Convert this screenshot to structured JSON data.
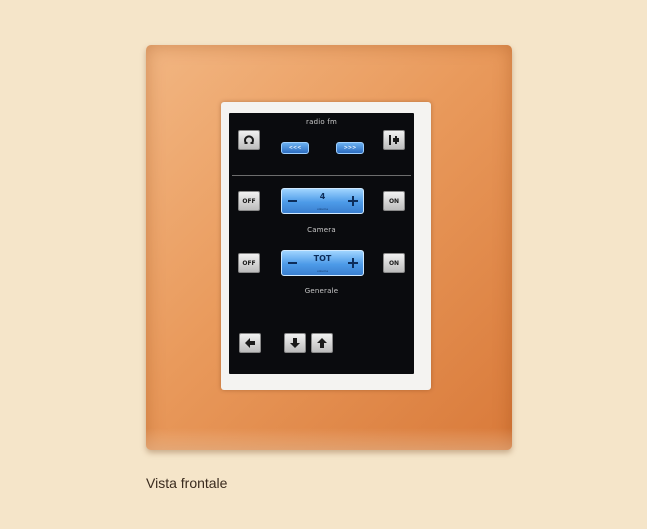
{
  "screen": {
    "header_label": "radio fm",
    "top_blue_buttons": [
      "<<<",
      ">>>"
    ],
    "section1_label": "Camera",
    "section2_label": "Generale",
    "off_label": "OFF",
    "on_label": "ON",
    "slider1": {
      "value": "4",
      "sub": "volume"
    },
    "slider2": {
      "value": "TOT",
      "sub": "volume"
    }
  },
  "caption": "Vista frontale",
  "colors": {
    "background": "#f5e5c9",
    "frame": "#e99a5c",
    "screen": "#0a0b0e",
    "accent_blue": "#4d9be8"
  }
}
